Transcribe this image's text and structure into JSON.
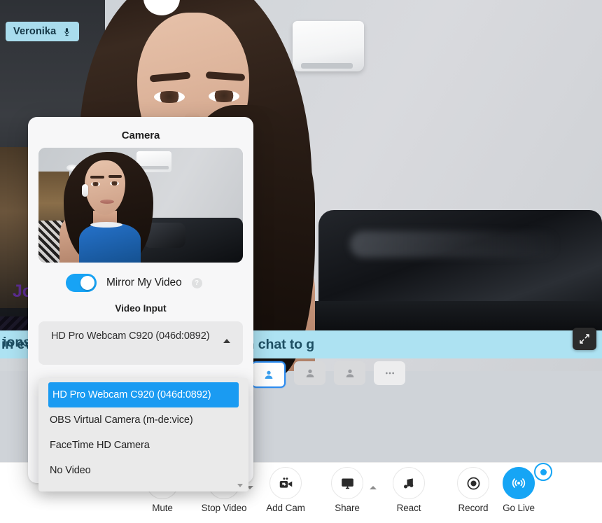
{
  "video": {
    "participant_name": "Veronika",
    "mic_icon": "microphone-icon",
    "lower_third_title": "Jo",
    "lower_third_stripe_text": "ions",
    "banner_text": "Tune in every Thursday and ask questions in chat to g",
    "expand_icon": "expand-arrows-icon"
  },
  "tiles": [
    {
      "icon": "person-icon",
      "selected": true
    },
    {
      "icon": "person-icon",
      "selected": false
    },
    {
      "icon": "person-icon",
      "selected": false
    },
    {
      "icon": "more-icon",
      "selected": false
    }
  ],
  "camera_popover": {
    "title": "Camera",
    "preview_label": "camera-preview",
    "mirror": {
      "label": "Mirror My Video",
      "enabled": true,
      "help_glyph": "?",
      "toggle_color": "#17a3f5"
    },
    "video_input": {
      "section_label": "Video Input",
      "selected_value": "HD Pro Webcam C920 (046d:0892)",
      "expanded": true,
      "options": [
        {
          "label": "HD Pro Webcam C920 (046d:0892)",
          "selected": true
        },
        {
          "label": "OBS Virtual Camera (m-de:vice)",
          "selected": false
        },
        {
          "label": "FaceTime HD Camera",
          "selected": false
        },
        {
          "label": "No Video",
          "selected": false
        }
      ]
    }
  },
  "toolbar": {
    "items": [
      {
        "label": "Mute",
        "icon": "microphone-icon",
        "caret": "down",
        "accent": false
      },
      {
        "label": "Stop Video",
        "icon": "video-camera-icon",
        "caret": "down",
        "accent": false
      },
      {
        "label": "Add Cam",
        "icon": "add-camera-icon",
        "caret": null,
        "accent": false
      },
      {
        "label": "Share",
        "icon": "screen-share-icon",
        "caret": "up",
        "accent": false
      },
      {
        "label": "React",
        "icon": "music-note-icon",
        "caret": null,
        "accent": false
      },
      {
        "label": "Record",
        "icon": "record-circle-icon",
        "caret": null,
        "accent": false
      },
      {
        "label": "Go Live",
        "icon": "broadcast-icon",
        "caret": null,
        "accent": true
      }
    ],
    "accent_color": "#16a5f5"
  }
}
